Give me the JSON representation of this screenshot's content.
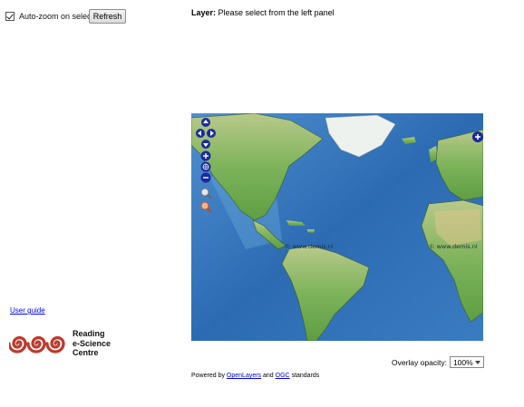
{
  "left_panel": {
    "autozoom_label": "Auto-zoom on select",
    "autozoom_checked": true,
    "refresh_label": "Refresh",
    "user_guide_label": "User guide",
    "logo_text": [
      "Reading",
      "e-Science",
      "Centre"
    ]
  },
  "main": {
    "layer_label": "Layer:",
    "layer_value": "Please select from the left panel",
    "map_watermark": "© www.demis.nl",
    "opacity_label": "Overlay opacity:",
    "opacity_value": "100%",
    "powered_prefix": "Powered by",
    "openlayers_link": "OpenLayers",
    "powered_and": "and",
    "ogc_link": "OGC",
    "powered_suffix": "standards"
  },
  "colors": {
    "ocean": "#2f6fb3",
    "land_green": "#6aa84f",
    "control_blue": "#1a2aa0",
    "link": "#0000ee",
    "logo_red": "#c0392b"
  }
}
